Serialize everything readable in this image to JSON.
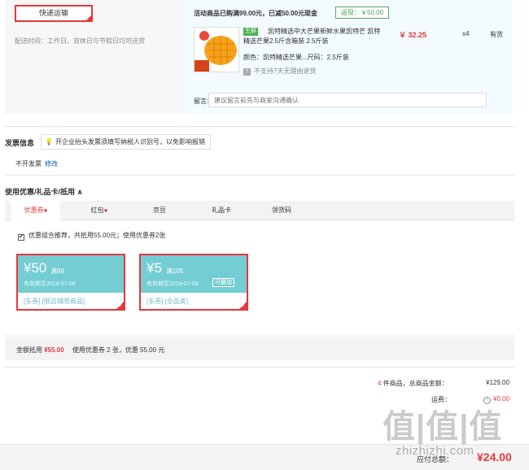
{
  "shipping": {
    "method": "快递运输",
    "delivery_time": "配送时间：工作日、双休日与节假日均可送货"
  },
  "promo": {
    "title": "活动商品已购满99.00元，已减50.00元现金",
    "badge": "返现：￥50.00"
  },
  "product": {
    "fresh_tag": "生鲜",
    "title": "凯特精选中大芒果新鲜水果凯特芒 凯特精选芒果2.5斤含箱装 2.5斤装",
    "price": "￥ 32.25",
    "qty": "x4",
    "stock": "有货",
    "spec": "颜色：凯特精选芒果...尺码：2.5斤装",
    "return_icon": "7",
    "return_policy": "不支持7天无理由退货",
    "image_label": "新鲜 到家"
  },
  "message": {
    "label": "留言:",
    "placeholder": "建议留言前先与商家沟通确认"
  },
  "invoice": {
    "title": "发票信息",
    "tip": "开企业抬头发票须填写纳税人识别号，以免影响报销",
    "value": "不开发票",
    "edit": "修改"
  },
  "coupons": {
    "title": "使用优惠/礼品卡/抵用 ∧",
    "tabs": [
      {
        "label": "优惠券",
        "dot": "●"
      },
      {
        "label": "红包",
        "dot": "●"
      },
      {
        "label": "京豆",
        "dot": ""
      },
      {
        "label": "礼品卡",
        "dot": ""
      },
      {
        "label": "领货码",
        "dot": ""
      }
    ],
    "combo_check": "✔",
    "combo_text": "优惠组合推荐，共抵用55.00元；使用优惠券2张",
    "items": [
      {
        "amount": "¥50",
        "condition": "满99",
        "expiry": "有效期至2019-07-08",
        "stackable": "",
        "scope": "[东券] [限店铺限商品]"
      },
      {
        "amount": "¥5",
        "condition": "满105",
        "expiry": "有效期至2019-07-08",
        "stackable": "可叠加",
        "scope": "[东券] [全品类]"
      }
    ],
    "selected_tick": "✓",
    "summary_label": "金额抵用",
    "summary_amount": "¥55.00",
    "summary_text": "使用优惠券 2 张，优惠 55.00 元"
  },
  "totals": {
    "items_count": "4",
    "items_text": "件商品，总商品金额：",
    "items_value": "¥129.00",
    "shipping_label": "运费：",
    "shipping_icon": "!",
    "shipping_value": "¥0.00",
    "pay_label": "应付总额：",
    "pay_value": "¥24.00"
  },
  "watermark": {
    "text": "值|值|值",
    "url": "zhizhizhi.com"
  },
  "colors": {
    "accent_red": "#e4393c",
    "coupon_teal": "#74cdd2",
    "fresh_green": "#4caf50"
  }
}
